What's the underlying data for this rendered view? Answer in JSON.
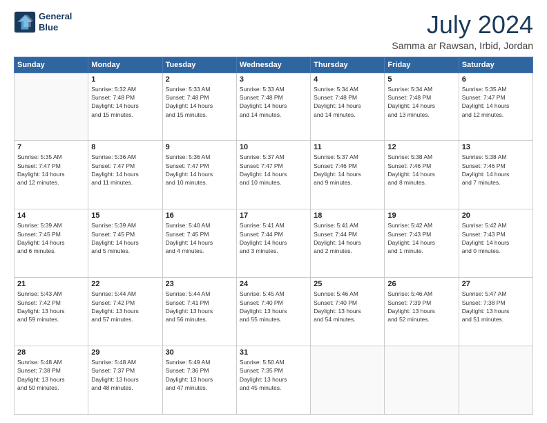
{
  "logo": {
    "line1": "General",
    "line2": "Blue"
  },
  "title": "July 2024",
  "location": "Samma ar Rawsan, Irbid, Jordan",
  "days_of_week": [
    "Sunday",
    "Monday",
    "Tuesday",
    "Wednesday",
    "Thursday",
    "Friday",
    "Saturday"
  ],
  "weeks": [
    [
      {
        "day": "",
        "sunrise": "",
        "sunset": "",
        "daylight": ""
      },
      {
        "day": "1",
        "sunrise": "Sunrise: 5:32 AM",
        "sunset": "Sunset: 7:48 PM",
        "daylight": "Daylight: 14 hours and 15 minutes."
      },
      {
        "day": "2",
        "sunrise": "Sunrise: 5:33 AM",
        "sunset": "Sunset: 7:48 PM",
        "daylight": "Daylight: 14 hours and 15 minutes."
      },
      {
        "day": "3",
        "sunrise": "Sunrise: 5:33 AM",
        "sunset": "Sunset: 7:48 PM",
        "daylight": "Daylight: 14 hours and 14 minutes."
      },
      {
        "day": "4",
        "sunrise": "Sunrise: 5:34 AM",
        "sunset": "Sunset: 7:48 PM",
        "daylight": "Daylight: 14 hours and 14 minutes."
      },
      {
        "day": "5",
        "sunrise": "Sunrise: 5:34 AM",
        "sunset": "Sunset: 7:48 PM",
        "daylight": "Daylight: 14 hours and 13 minutes."
      },
      {
        "day": "6",
        "sunrise": "Sunrise: 5:35 AM",
        "sunset": "Sunset: 7:47 PM",
        "daylight": "Daylight: 14 hours and 12 minutes."
      }
    ],
    [
      {
        "day": "7",
        "sunrise": "Sunrise: 5:35 AM",
        "sunset": "Sunset: 7:47 PM",
        "daylight": "Daylight: 14 hours and 12 minutes."
      },
      {
        "day": "8",
        "sunrise": "Sunrise: 5:36 AM",
        "sunset": "Sunset: 7:47 PM",
        "daylight": "Daylight: 14 hours and 11 minutes."
      },
      {
        "day": "9",
        "sunrise": "Sunrise: 5:36 AM",
        "sunset": "Sunset: 7:47 PM",
        "daylight": "Daylight: 14 hours and 10 minutes."
      },
      {
        "day": "10",
        "sunrise": "Sunrise: 5:37 AM",
        "sunset": "Sunset: 7:47 PM",
        "daylight": "Daylight: 14 hours and 10 minutes."
      },
      {
        "day": "11",
        "sunrise": "Sunrise: 5:37 AM",
        "sunset": "Sunset: 7:46 PM",
        "daylight": "Daylight: 14 hours and 9 minutes."
      },
      {
        "day": "12",
        "sunrise": "Sunrise: 5:38 AM",
        "sunset": "Sunset: 7:46 PM",
        "daylight": "Daylight: 14 hours and 8 minutes."
      },
      {
        "day": "13",
        "sunrise": "Sunrise: 5:38 AM",
        "sunset": "Sunset: 7:46 PM",
        "daylight": "Daylight: 14 hours and 7 minutes."
      }
    ],
    [
      {
        "day": "14",
        "sunrise": "Sunrise: 5:39 AM",
        "sunset": "Sunset: 7:45 PM",
        "daylight": "Daylight: 14 hours and 6 minutes."
      },
      {
        "day": "15",
        "sunrise": "Sunrise: 5:39 AM",
        "sunset": "Sunset: 7:45 PM",
        "daylight": "Daylight: 14 hours and 5 minutes."
      },
      {
        "day": "16",
        "sunrise": "Sunrise: 5:40 AM",
        "sunset": "Sunset: 7:45 PM",
        "daylight": "Daylight: 14 hours and 4 minutes."
      },
      {
        "day": "17",
        "sunrise": "Sunrise: 5:41 AM",
        "sunset": "Sunset: 7:44 PM",
        "daylight": "Daylight: 14 hours and 3 minutes."
      },
      {
        "day": "18",
        "sunrise": "Sunrise: 5:41 AM",
        "sunset": "Sunset: 7:44 PM",
        "daylight": "Daylight: 14 hours and 2 minutes."
      },
      {
        "day": "19",
        "sunrise": "Sunrise: 5:42 AM",
        "sunset": "Sunset: 7:43 PM",
        "daylight": "Daylight: 14 hours and 1 minute."
      },
      {
        "day": "20",
        "sunrise": "Sunrise: 5:42 AM",
        "sunset": "Sunset: 7:43 PM",
        "daylight": "Daylight: 14 hours and 0 minutes."
      }
    ],
    [
      {
        "day": "21",
        "sunrise": "Sunrise: 5:43 AM",
        "sunset": "Sunset: 7:42 PM",
        "daylight": "Daylight: 13 hours and 59 minutes."
      },
      {
        "day": "22",
        "sunrise": "Sunrise: 5:44 AM",
        "sunset": "Sunset: 7:42 PM",
        "daylight": "Daylight: 13 hours and 57 minutes."
      },
      {
        "day": "23",
        "sunrise": "Sunrise: 5:44 AM",
        "sunset": "Sunset: 7:41 PM",
        "daylight": "Daylight: 13 hours and 56 minutes."
      },
      {
        "day": "24",
        "sunrise": "Sunrise: 5:45 AM",
        "sunset": "Sunset: 7:40 PM",
        "daylight": "Daylight: 13 hours and 55 minutes."
      },
      {
        "day": "25",
        "sunrise": "Sunrise: 5:46 AM",
        "sunset": "Sunset: 7:40 PM",
        "daylight": "Daylight: 13 hours and 54 minutes."
      },
      {
        "day": "26",
        "sunrise": "Sunrise: 5:46 AM",
        "sunset": "Sunset: 7:39 PM",
        "daylight": "Daylight: 13 hours and 52 minutes."
      },
      {
        "day": "27",
        "sunrise": "Sunrise: 5:47 AM",
        "sunset": "Sunset: 7:38 PM",
        "daylight": "Daylight: 13 hours and 51 minutes."
      }
    ],
    [
      {
        "day": "28",
        "sunrise": "Sunrise: 5:48 AM",
        "sunset": "Sunset: 7:38 PM",
        "daylight": "Daylight: 13 hours and 50 minutes."
      },
      {
        "day": "29",
        "sunrise": "Sunrise: 5:48 AM",
        "sunset": "Sunset: 7:37 PM",
        "daylight": "Daylight: 13 hours and 48 minutes."
      },
      {
        "day": "30",
        "sunrise": "Sunrise: 5:49 AM",
        "sunset": "Sunset: 7:36 PM",
        "daylight": "Daylight: 13 hours and 47 minutes."
      },
      {
        "day": "31",
        "sunrise": "Sunrise: 5:50 AM",
        "sunset": "Sunset: 7:35 PM",
        "daylight": "Daylight: 13 hours and 45 minutes."
      },
      {
        "day": "",
        "sunrise": "",
        "sunset": "",
        "daylight": ""
      },
      {
        "day": "",
        "sunrise": "",
        "sunset": "",
        "daylight": ""
      },
      {
        "day": "",
        "sunrise": "",
        "sunset": "",
        "daylight": ""
      }
    ]
  ]
}
